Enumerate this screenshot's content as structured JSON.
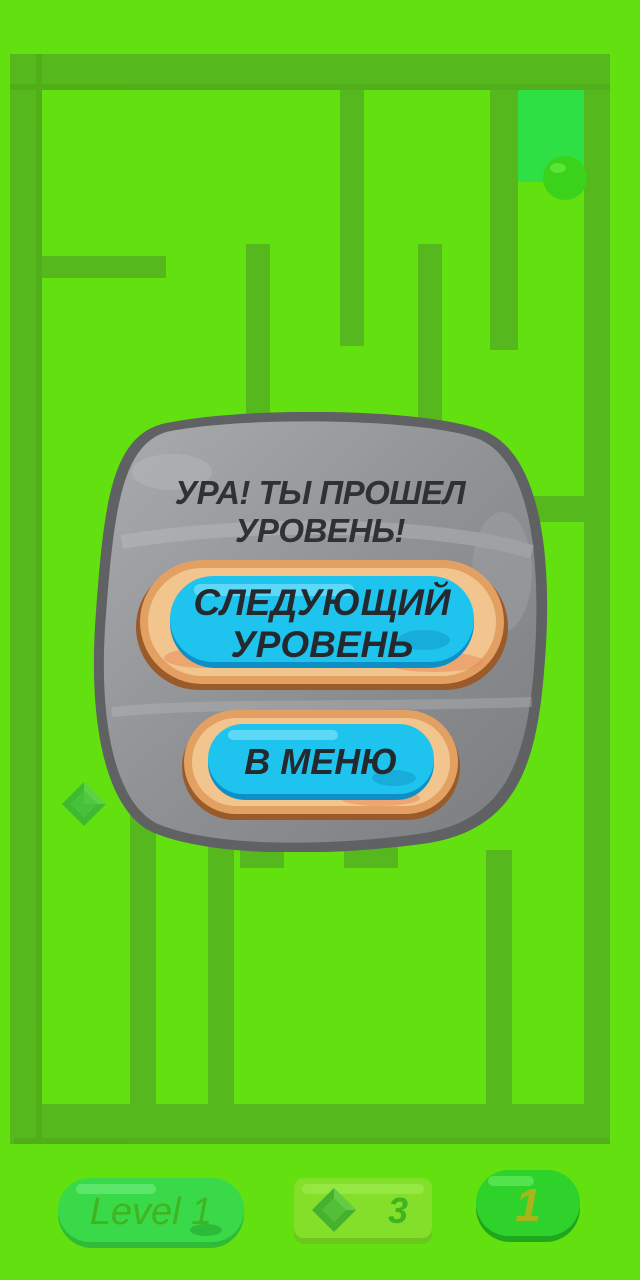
{
  "dialog": {
    "title": "УРА! ТЫ ПРОШЕЛ УРОВЕНЬ!",
    "next_label": "СЛЕДУЮЩИЙ УРОВЕНЬ",
    "menu_label": "В МЕНЮ"
  },
  "hud": {
    "level_label": "Level 1",
    "gems_count": "3",
    "counter_value": "1"
  },
  "icons": {
    "gem": "gem-icon",
    "ball": "ball-icon",
    "goal": "goal-zone"
  },
  "colors": {
    "background": "#63e010",
    "maze_wall": "#55b81d",
    "goal": "#2fe044",
    "ball": "#3ad21a",
    "dialog_stone": "#8d8f92",
    "button_blue": "#1fc4ee",
    "button_frame": "#e0a060"
  }
}
